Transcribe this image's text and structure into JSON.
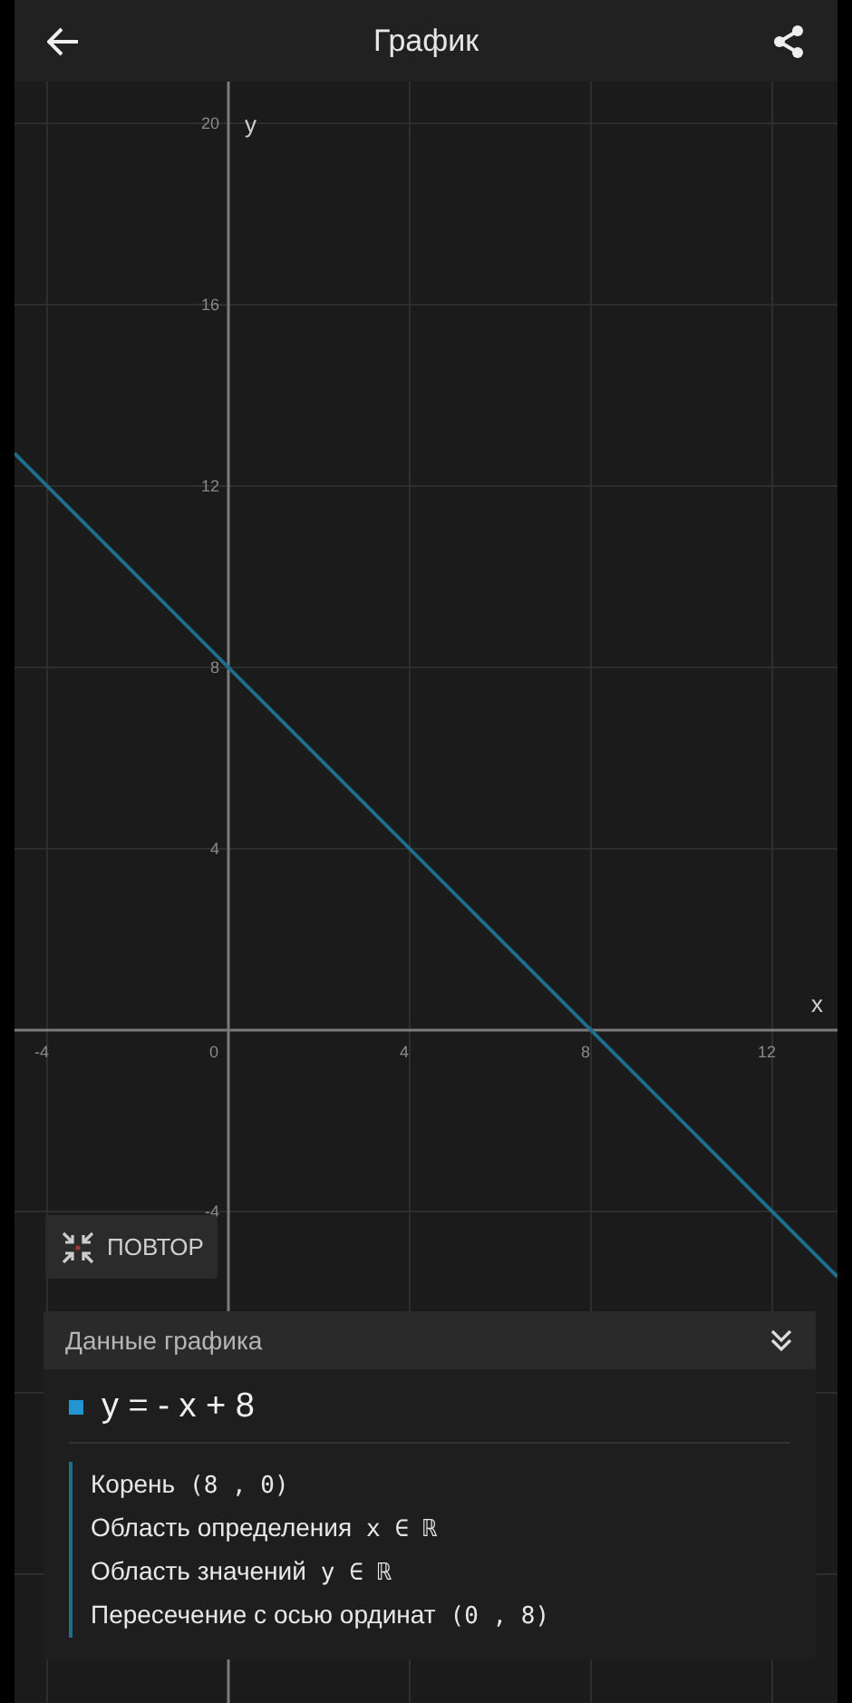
{
  "app_bar": {
    "title": "График"
  },
  "chart": {
    "chart_data": {
      "type": "line",
      "xlabel": "x",
      "ylabel": "y",
      "x": [
        -4.72,
        13.44
      ],
      "grid": true,
      "series": [
        {
          "color": "#1d6d8f",
          "values": [
            12.72,
            -5.44
          ]
        }
      ],
      "xlim": [
        -4.72,
        13.44
      ],
      "ylim": [
        -14.84,
        20.92
      ],
      "xticks": [
        -4,
        0,
        4,
        8,
        12
      ],
      "yticks": [
        -4,
        4,
        8,
        12,
        16,
        20
      ]
    }
  },
  "replay_button": {
    "label": "ПОВТОР"
  },
  "data_panel": {
    "title": "Данные графика",
    "functions": [
      {
        "equation": "y = - x + 8",
        "color": "#2196d3",
        "details": [
          {
            "label": "Корень",
            "value": "(8 , 0)"
          },
          {
            "label": "Область определения",
            "value": "x ∈ ℝ"
          },
          {
            "label": "Область значений",
            "value": "y ∈ ℝ"
          },
          {
            "label": "Пересечение с осью ординат",
            "value": "(0 , 8)"
          }
        ]
      }
    ]
  }
}
